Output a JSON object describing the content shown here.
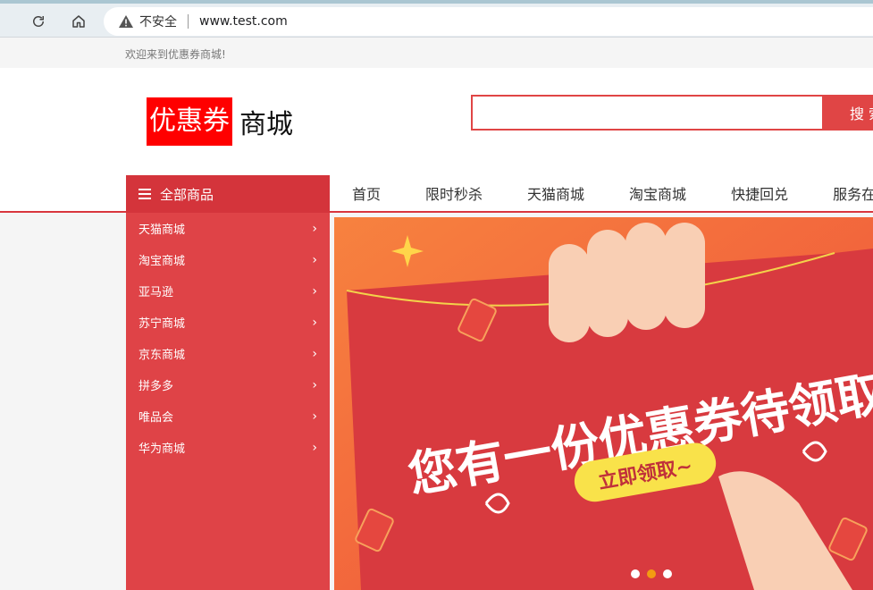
{
  "browser": {
    "security_label": "不安全",
    "url": "www.test.com"
  },
  "topbar": {
    "welcome": "欢迎来到优惠券商城!"
  },
  "header": {
    "logo_red": "优惠券",
    "logo_black": "商城",
    "search_value": "",
    "search_button": "搜 索"
  },
  "nav": {
    "all_categories": "全部商品",
    "links": [
      "首页",
      "限时秒杀",
      "天猫商城",
      "淘宝商城",
      "快捷回兑",
      "服务在线"
    ]
  },
  "sidebar": {
    "items": [
      "天猫商城",
      "淘宝商城",
      "亚马逊",
      "苏宁商城",
      "京东商城",
      "拼多多",
      "唯品会",
      "华为商城"
    ]
  },
  "banner": {
    "headline": "您有一份优惠券待领取",
    "cta": "立即领取~",
    "dots_total": 3,
    "active_dot": 2
  },
  "colors": {
    "brand_red": "#e04545",
    "sidebar_red": "#df4347",
    "logo_red": "#ff0000",
    "dot_active": "#f39c12"
  }
}
